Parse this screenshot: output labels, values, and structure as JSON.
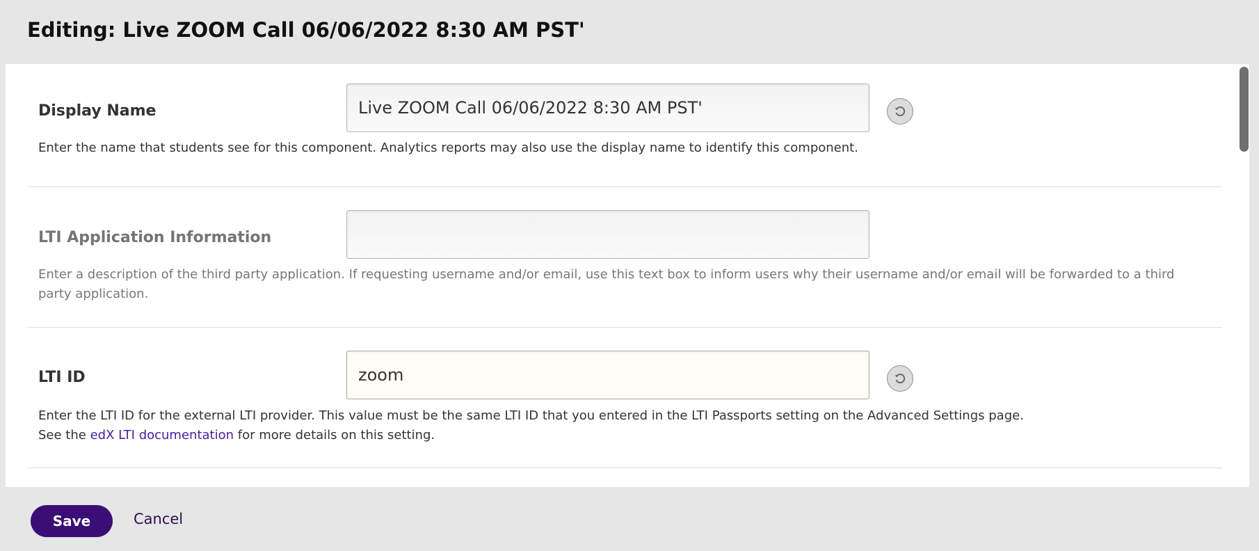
{
  "header": {
    "title": "Editing: Live ZOOM Call 06/06/2022 8:30 AM PST'"
  },
  "fields": {
    "display_name": {
      "label": "Display Name",
      "value": "Live ZOOM Call 06/06/2022 8:30 AM PST'",
      "help": "Enter the name that students see for this component. Analytics reports may also use the display name to identify this component."
    },
    "lti_app_info": {
      "label": "LTI Application Information",
      "value": "",
      "help": "Enter a description of the third party application. If requesting username and/or email, use this text box to inform users why their username and/or email will be forwarded to a third party application."
    },
    "lti_id": {
      "label": "LTI ID",
      "value": "zoom",
      "help_line1": "Enter the LTI ID for the external LTI provider. This value must be the same LTI ID that you entered in the LTI Passports setting on the Advanced Settings page.",
      "help_prefix": "See the ",
      "help_link": "edX LTI documentation",
      "help_suffix": " for more details on this setting."
    }
  },
  "icons": {
    "reset": "reset-undo-icon"
  },
  "footer": {
    "save_label": "Save",
    "cancel_label": "Cancel"
  },
  "colors": {
    "accent": "#3a0e74",
    "link": "#4a1c9a"
  }
}
